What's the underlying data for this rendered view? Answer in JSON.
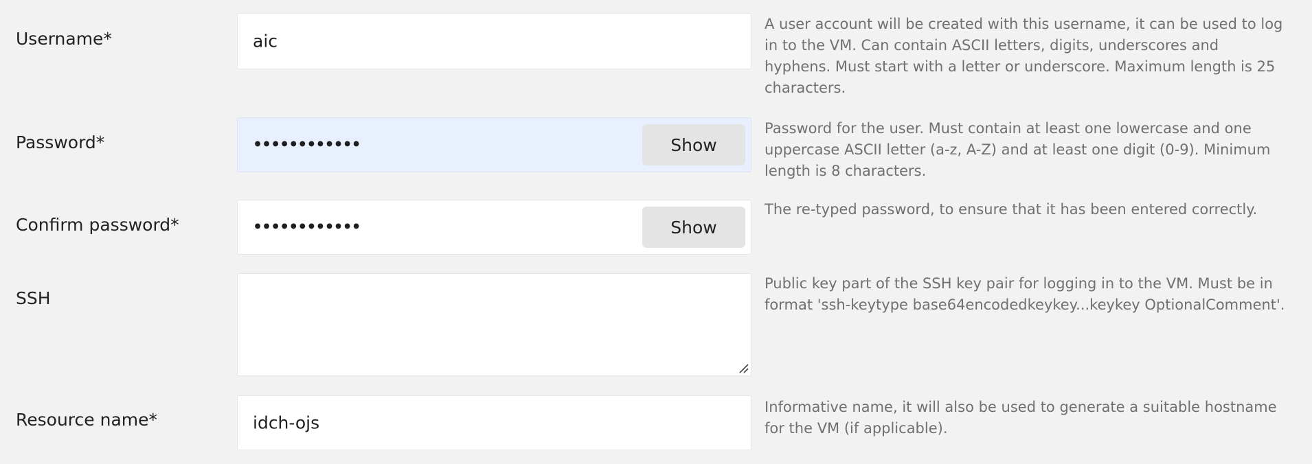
{
  "username": {
    "label": "Username*",
    "value": "aic",
    "help": "A user account will be created with this username, it can be used to log in to the VM. Can contain ASCII letters, digits, underscores and hyphens. Must start with a letter or underscore. Maximum length is 25 characters."
  },
  "password": {
    "label": "Password*",
    "masked_value": "••••••••••••",
    "show_label": "Show",
    "help": "Password for the user. Must contain at least one lowercase and one uppercase ASCII letter (a-z, A-Z) and at least one digit (0-9). Minimum length is 8 characters."
  },
  "confirm_password": {
    "label": "Confirm password*",
    "masked_value": "••••••••••••",
    "show_label": "Show",
    "help": "The re-typed password, to ensure that it has been entered correctly."
  },
  "ssh": {
    "label": "SSH",
    "value": "",
    "help": "Public key part of the SSH key pair for logging in to the VM. Must be in format 'ssh-keytype base64encodedkeykey...keykey OptionalComment'."
  },
  "resource_name": {
    "label": "Resource name*",
    "value": "idch-ojs",
    "help": "Informative name, it will also be used to generate a suitable hostname for the VM (if applicable)."
  },
  "colors": {
    "page_background": "#f2f2f2",
    "autofill_background": "#e8f0fe",
    "button_background": "#e4e4e4",
    "help_text": "#707070"
  }
}
